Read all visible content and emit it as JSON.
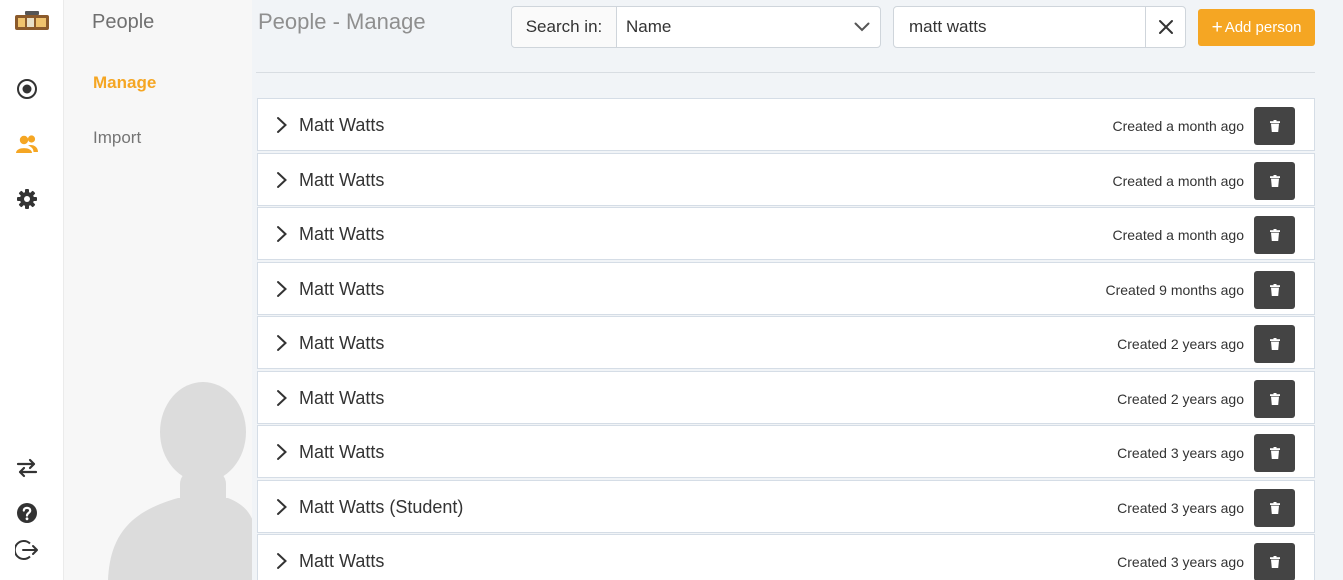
{
  "rail": {
    "logo_icon": "app-logo",
    "top_icons": [
      "dashboard-icon",
      "people-icon",
      "settings-icon"
    ],
    "bottom_icons": [
      "switch-icon",
      "help-icon",
      "logout-icon"
    ],
    "active_color": "#f5a623"
  },
  "subnav": {
    "title": "People",
    "items": [
      {
        "label": "Manage",
        "active": true
      },
      {
        "label": "Import",
        "active": false
      }
    ]
  },
  "main": {
    "title": "People - Manage",
    "search": {
      "label": "Search in:",
      "field": "Name",
      "query": "matt watts"
    },
    "add_button": {
      "icon": "+",
      "label": "Add person"
    },
    "people": [
      {
        "name": "Matt Watts",
        "created": "Created a month ago"
      },
      {
        "name": "Matt Watts",
        "created": "Created a month ago"
      },
      {
        "name": "Matt Watts",
        "created": "Created a month ago"
      },
      {
        "name": "Matt Watts",
        "created": "Created 9 months ago"
      },
      {
        "name": "Matt Watts",
        "created": "Created 2 years ago"
      },
      {
        "name": "Matt Watts",
        "created": "Created 2 years ago"
      },
      {
        "name": "Matt Watts",
        "created": "Created 3 years ago"
      },
      {
        "name": "Matt Watts (Student)",
        "created": "Created 3 years ago"
      },
      {
        "name": "Matt Watts",
        "created": "Created 3 years ago"
      }
    ]
  },
  "colors": {
    "accent": "#f5a623",
    "delete_button": "#444444",
    "main_background": "#f1f4f7"
  }
}
